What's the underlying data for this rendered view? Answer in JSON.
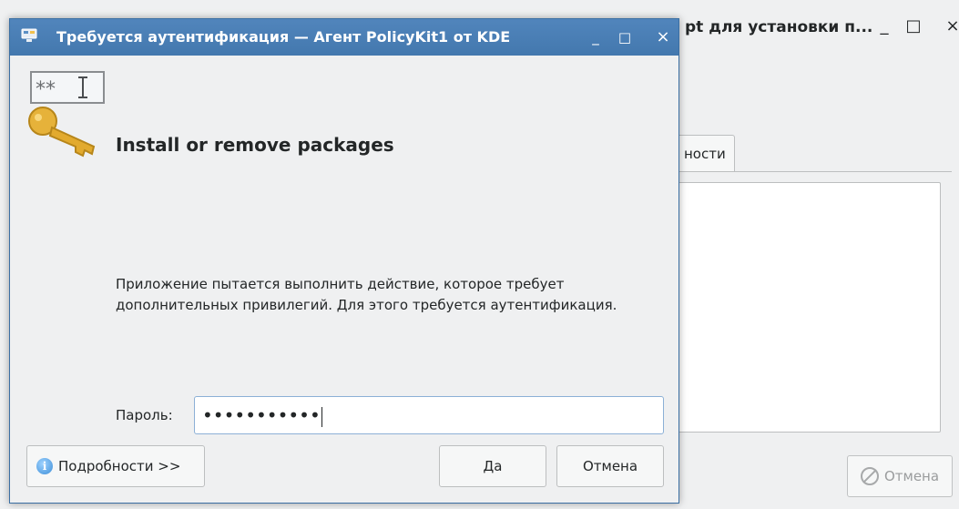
{
  "background_window": {
    "title": "pt для установки п...",
    "controls": {
      "minimize": "_",
      "maximize": "□",
      "close": "×"
    },
    "tab_label": "ности",
    "cancel_button": "Отмена"
  },
  "dialog": {
    "title": "Требуется аутентификация — Агент PolicyKit1 от KDE",
    "controls": {
      "minimize": "_",
      "maximize": "□",
      "close": "×"
    },
    "action_title": "Install or remove packages",
    "message": "Приложение пытается выполнить действие, которое требует дополнительных привилегий. Для этого требуется аутентификация.",
    "password_label": "Пароль:",
    "password_value": "•••••••••••",
    "details_button": "Подробности >>",
    "yes_button": "Да",
    "cancel_button": "Отмена"
  },
  "icons": {
    "dialog_app": "kde-agent-icon",
    "dialog_key": "password-key-icon",
    "details": "info-icon",
    "bg_cancel": "cancel-icon"
  },
  "colors": {
    "titlebar": "#4a7eb5",
    "window_bg": "#eff0f1",
    "input_focus_border": "#8cb0d6"
  }
}
